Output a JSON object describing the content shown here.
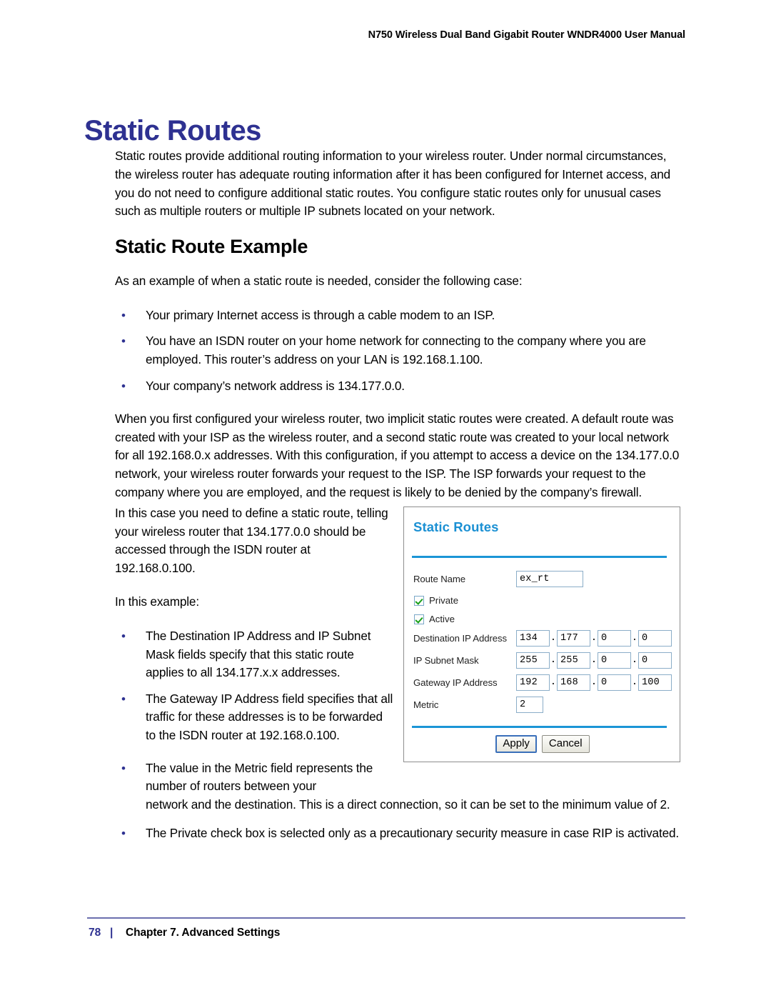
{
  "header": {
    "running_title": "N750 Wireless Dual Band Gigabit Router WNDR4000 User Manual"
  },
  "page_title": "Static Routes",
  "intro_paragraph": "Static routes provide additional routing information to your wireless router. Under normal circumstances, the wireless router has adequate routing information after it has been configured for Internet access, and you do not need to configure additional static routes. You configure static routes only for unusual cases such as multiple routers or multiple IP subnets located on your network.",
  "section": {
    "heading": "Static Route Example",
    "lead_in": "As an example of when a static route is needed, consider the following case:",
    "case_bullets": [
      "Your primary Internet access is through a cable modem to an ISP.",
      "You have an ISDN router on your home network for connecting to the company where you are employed. This router’s address on your LAN is 192.168.1.100.",
      "Your company’s network address is 134.177.0.0."
    ],
    "explanation": "When you first configured your wireless router, two implicit static routes were created. A default route was created with your ISP as the wireless router, and a second static route was created to your local network for all 192.168.0.x addresses. With this configuration, if you attempt to access a device on the 134.177.0.0 network, your wireless router forwards your request to the ISP. The ISP forwards your request to the company where you are employed, and the request is likely to be denied by the company’s firewall.",
    "define_paragraph": "In this case you need to define a static route, telling your wireless router that 134.177.0.0 should be accessed through the ISDN router at 192.168.0.100.",
    "example_lead_in": "In this example:",
    "example_bullets": [
      "The Destination IP Address and IP Subnet Mask fields specify that this static route applies to all 134.177.x.x addresses.",
      "The Gateway IP Address field specifies that all traffic for these addresses is to be forwarded to the ISDN router at 192.168.0.100.",
      "The value in the Metric field represents the number of routers between your",
      "The Private check box is selected only as a precautionary security measure in case RIP is activated."
    ],
    "metric_bullet_continuation": "network and the destination. This is a direct connection, so it can be set to the minimum value of 2."
  },
  "bullet_glyph": "•",
  "dialog": {
    "title": "Static Routes",
    "fields": {
      "route_name": {
        "label": "Route Name",
        "value": "ex_rt"
      },
      "private": {
        "label": "Private",
        "checked": true
      },
      "active": {
        "label": "Active",
        "checked": true
      },
      "destination_ip": {
        "label": "Destination IP Address",
        "octets": [
          "134",
          "177",
          "0",
          "0"
        ]
      },
      "subnet_mask": {
        "label": "IP Subnet Mask",
        "octets": [
          "255",
          "255",
          "0",
          "0"
        ]
      },
      "gateway_ip": {
        "label": "Gateway IP Address",
        "octets": [
          "192",
          "168",
          "0",
          "100"
        ]
      },
      "metric": {
        "label": "Metric",
        "value": "2"
      }
    },
    "octet_separator": ".",
    "buttons": {
      "apply": "Apply",
      "cancel": "Cancel"
    }
  },
  "footer": {
    "page_number": "78",
    "separator": "|",
    "chapter": "Chapter 7. Advanced Settings"
  },
  "colors": {
    "heading_blue": "#2e3191",
    "dialog_blue": "#1b90d3",
    "rule_blue": "#1b95d6",
    "footer_rule": "#6b6fae",
    "check_green": "#19a019"
  }
}
